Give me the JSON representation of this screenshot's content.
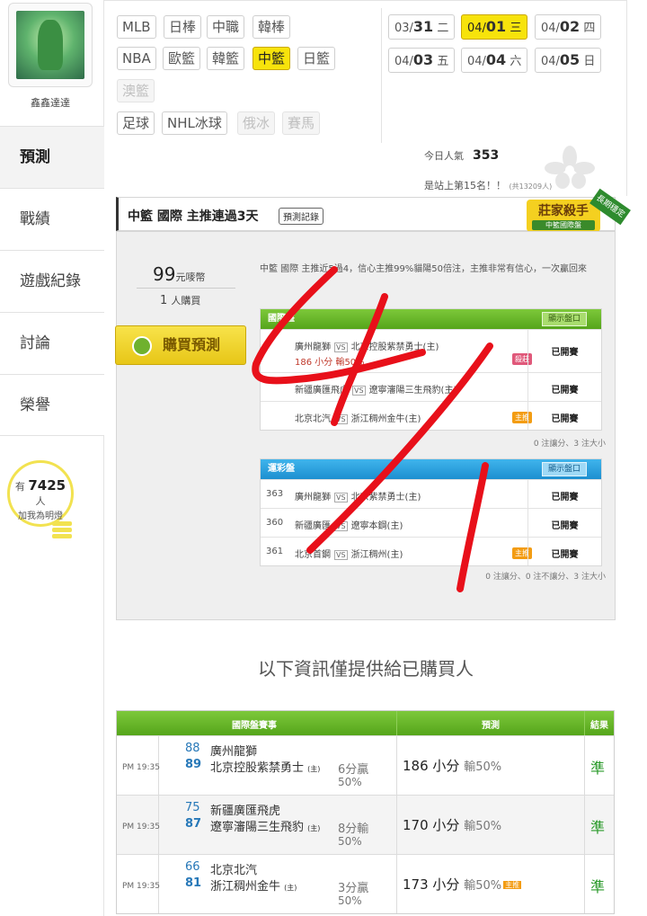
{
  "user": {
    "name": "鑫鑫達達"
  },
  "nav": [
    {
      "label": "預測",
      "active": true
    },
    {
      "label": "戰績"
    },
    {
      "label": "遊戲紀錄"
    },
    {
      "label": "討論"
    },
    {
      "label": "榮譽"
    }
  ],
  "lightbulb": {
    "prefix": "有",
    "count": "7425",
    "suffix": "人",
    "text": "加我為明燈"
  },
  "sports": {
    "row1": [
      "MLB",
      "日棒",
      "中職",
      "韓棒"
    ],
    "row2": [
      "NBA",
      "歐籃",
      "韓籃",
      "中籃",
      "日籃"
    ],
    "row3": [
      "澳籃"
    ],
    "row4": [
      "足球",
      "NHL冰球",
      "俄冰",
      "賽馬"
    ]
  },
  "dates": [
    {
      "m": "03/",
      "d": "31",
      "w": "二"
    },
    {
      "m": "04/",
      "d": "01",
      "w": "三"
    },
    {
      "m": "04/",
      "d": "02",
      "w": "四"
    },
    {
      "m": "04/",
      "d": "03",
      "w": "五"
    },
    {
      "m": "04/",
      "d": "04",
      "w": "六"
    },
    {
      "m": "04/",
      "d": "05",
      "w": "日"
    }
  ],
  "stats": {
    "today_label": "今日人氣",
    "today_value": "353",
    "rank_text": "是站上第15名！！",
    "rank_note": "(共13209人)"
  },
  "header": {
    "title": "中籃 國際 主推連過3天",
    "record_button": "預測記錄",
    "badge_title": "莊家殺手",
    "badge_sub": "中籃國際盤",
    "badge_ribbon": "長期穩定"
  },
  "card": {
    "price": "99",
    "price_unit": "元嘜幣",
    "buyers": "1",
    "buyers_unit": "人購買",
    "buy_button": "購買預測",
    "description": "中籃 國際 主推近5過4，信心主推99%貓陽50倍注，主推非常有信心，一次贏回來"
  },
  "intl_table": {
    "title": "國際盤",
    "show_button": "顯示盤口",
    "rows": [
      {
        "away": "廣州龍獅",
        "home": "北京控股紫禁勇士(主)",
        "sub": "186 小分 輸50%",
        "tag": "殺莊",
        "status": "已開賽"
      },
      {
        "away": "新疆廣匯飛虎",
        "home": "遼寧瀋陽三生飛豹(主)",
        "sub": "",
        "tag": "",
        "status": "已開賽"
      },
      {
        "away": "北京北汽",
        "home": "浙江稠州金牛(主)",
        "sub": "",
        "tag": "主推",
        "status": "已開賽"
      }
    ],
    "note": "0 注讓分、3 注大小"
  },
  "lottery_table": {
    "title": "運彩盤",
    "show_button": "顯示盤口",
    "rows": [
      {
        "no": "363",
        "away": "廣州龍獅",
        "home": "北京紫禁勇士(主)",
        "tag": "",
        "status": "已開賽"
      },
      {
        "no": "360",
        "away": "新疆廣匯",
        "home": "遼寧本鋼(主)",
        "tag": "",
        "status": "已開賽"
      },
      {
        "no": "361",
        "away": "北京首鋼",
        "home": "浙江稠州(主)",
        "tag": "主推",
        "status": "已開賽"
      }
    ],
    "note": "0 注讓分、0 注不讓分、3 注大小"
  },
  "notice": "以下資訊僅提供給已購買人",
  "result_table": {
    "headers": {
      "events": "國際盤賽事",
      "prediction": "預測",
      "result": "結果"
    },
    "rows": [
      {
        "time": "PM 19:35",
        "n1": "88",
        "t1": "廣州龍獅",
        "n2": "89",
        "t2": "北京控股紫禁勇士",
        "home": "(主)",
        "spread": "6分贏",
        "pct": "50%",
        "pred": "186 小分",
        "pred_res": "輸50%",
        "tag": "",
        "result": "準"
      },
      {
        "time": "PM 19:35",
        "n1": "75",
        "t1": "新疆廣匯飛虎",
        "n2": "87",
        "t2": "遼寧瀋陽三生飛豹",
        "home": "(主)",
        "spread": "8分輸",
        "pct": "50%",
        "pred": "170 小分",
        "pred_res": "輸50%",
        "tag": "",
        "result": "準"
      },
      {
        "time": "PM 19:35",
        "n1": "66",
        "t1": "北京北汽",
        "n2": "81",
        "t2": "浙江稠州金牛",
        "home": "(主)",
        "spread": "3分贏",
        "pct": "50%",
        "pred": "173 小分",
        "pred_res": "輸50%",
        "tag": "主推",
        "result": "準"
      }
    ]
  },
  "colors": {
    "accent_yellow": "#f7e30b",
    "green_header": "#55a51b",
    "blue_header": "#1d8fd0",
    "result_green": "#2a9a2a",
    "scribble_red": "#e8101a"
  }
}
